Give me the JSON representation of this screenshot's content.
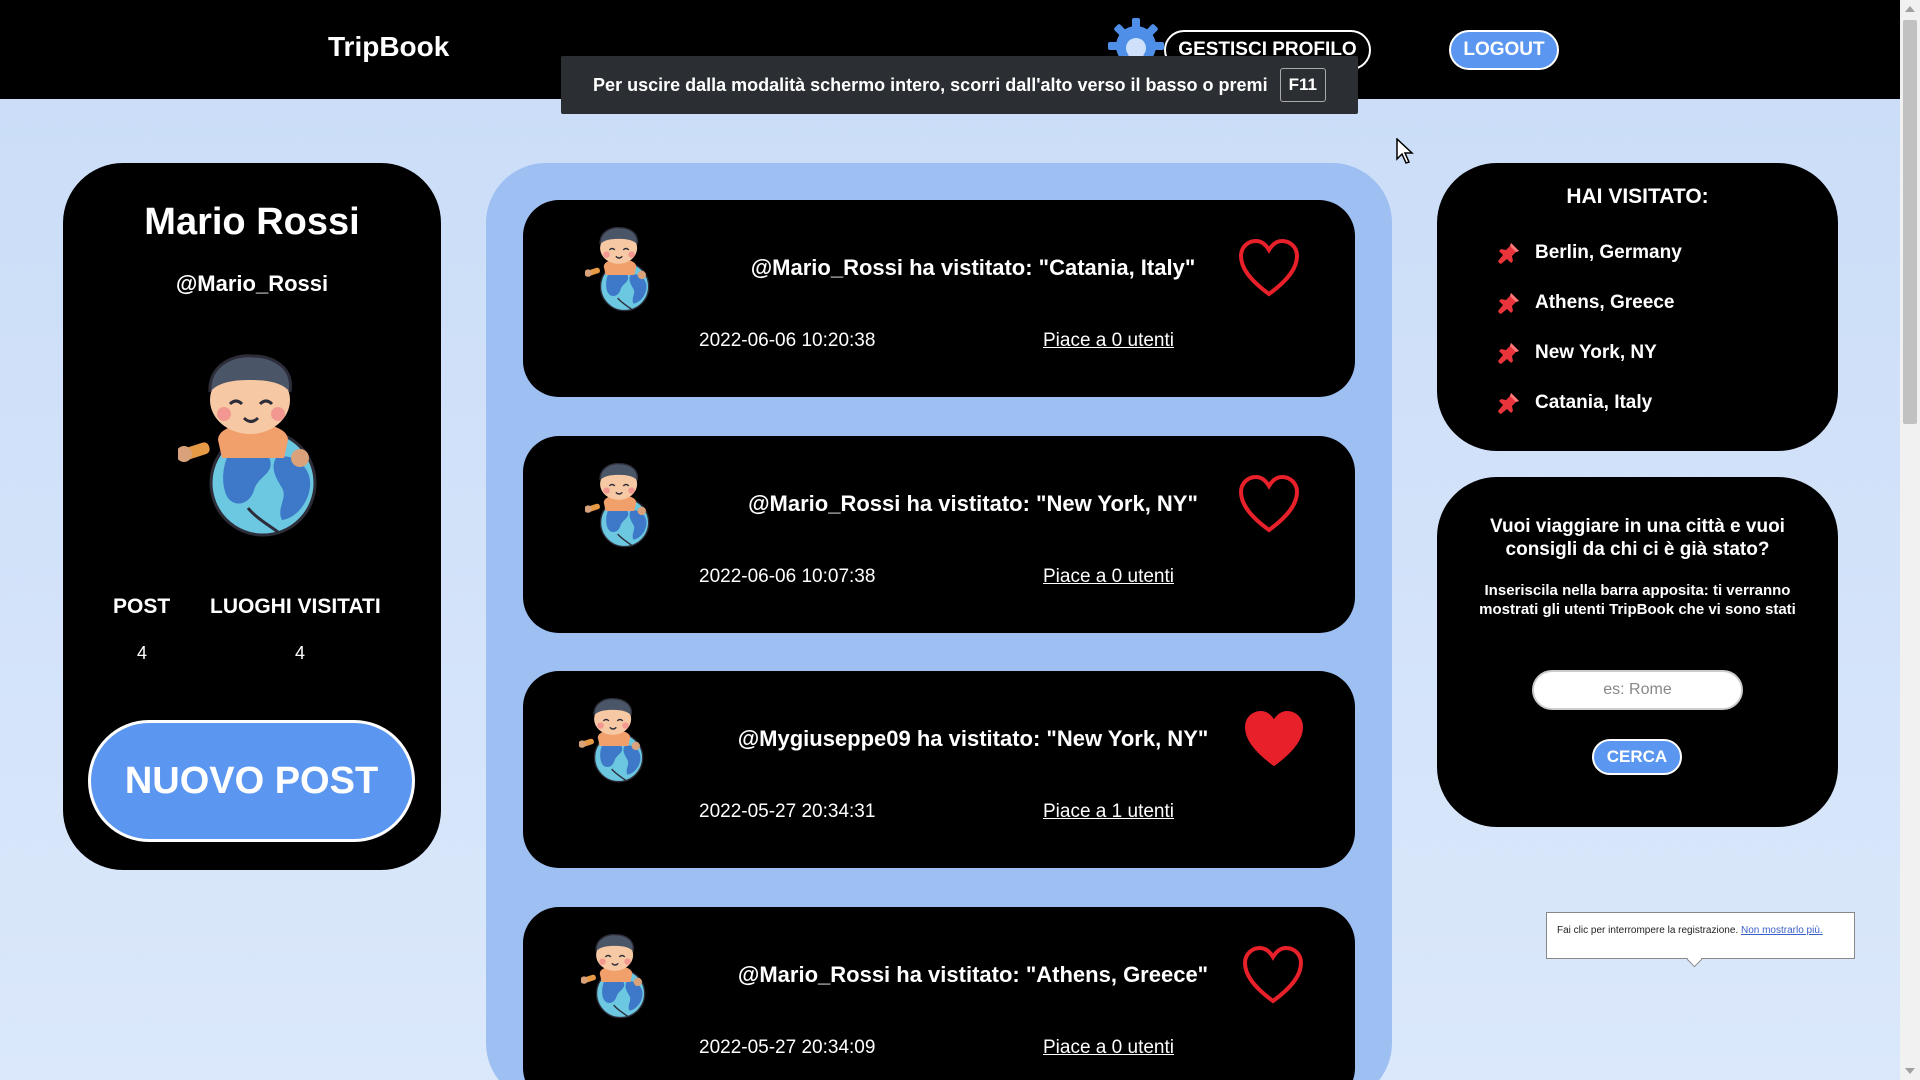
{
  "app": {
    "brand": "TripBook",
    "manage_profile_label": "GESTISCI PROFILO",
    "logout_label": "LOGOUT"
  },
  "fullscreen_notice": {
    "text": "Per uscire dalla modalità schermo intero, scorri dall'alto verso il basso o premi",
    "key": "F11"
  },
  "profile": {
    "name": "Mario Rossi",
    "handle": "@Mario_Rossi",
    "stats": [
      {
        "label": "POST",
        "value": "4"
      },
      {
        "label": "LUOGHI VISITATI",
        "value": "4"
      }
    ],
    "new_post_label": "NUOVO POST"
  },
  "posts": [
    {
      "title": "@Mario_Rossi ha vistitato: \"Catania, Italy\"",
      "date": "2022-06-06 10:20:38",
      "likes": "Piace a 0 utenti",
      "liked": false
    },
    {
      "title": "@Mario_Rossi ha vistitato: \"New York, NY\"",
      "date": "2022-06-06 10:07:38",
      "likes": "Piace a 0 utenti",
      "liked": false
    },
    {
      "title": "@Mygiuseppe09 ha vistitato: \"New York, NY\"",
      "date": "2022-05-27 20:34:31",
      "likes": "Piace a 1 utenti",
      "liked": true
    },
    {
      "title": "@Mario_Rossi ha vistitato: \"Athens, Greece\"",
      "date": "2022-05-27 20:34:09",
      "likes": "Piace a 0 utenti",
      "liked": false
    }
  ],
  "visited": {
    "title": "HAI VISITATO:",
    "places": [
      "Berlin, Germany",
      "Athens, Greece",
      "New York, NY",
      "Catania, Italy"
    ]
  },
  "search": {
    "question": "Vuoi viaggiare in una città e vuoi consigli da chi ci è già stato?",
    "hint": "Inseriscila nella barra apposita: ti verranno mostrati gli utenti TripBook che vi sono stati",
    "placeholder": "es: Rome",
    "button_label": "CERCA"
  },
  "recording_tooltip": {
    "text": "Fai clic per interrompere la registrazione.",
    "link": "Non mostrarlo più."
  },
  "colors": {
    "accent": "#5b97f0",
    "heart": "#e8202a",
    "page_bg": "#c9dcf7",
    "feed_bg": "#9ebff2"
  },
  "icons": {
    "settings": "gear-icon",
    "pin": "pushpin-icon",
    "like": "heart-icon",
    "avatar": "globe-boy-avatar"
  }
}
